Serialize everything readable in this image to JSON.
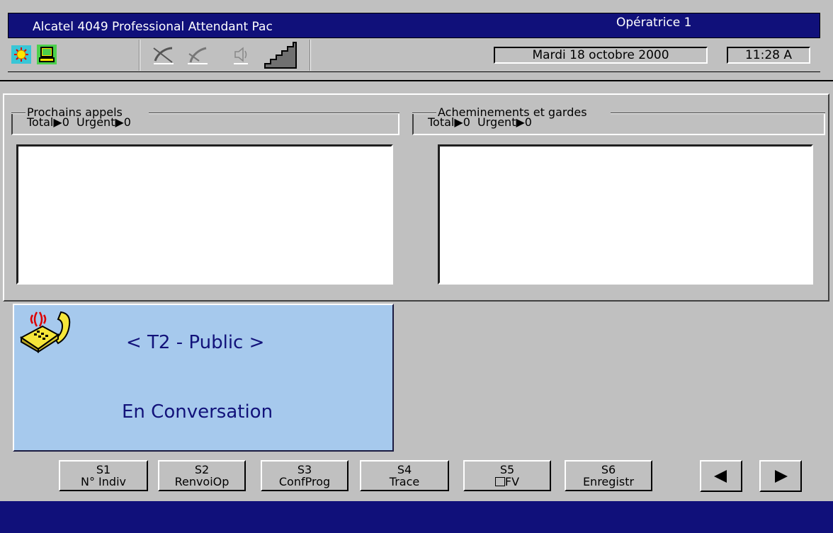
{
  "window": {
    "title": "Alcatel 4049 Professional Attendant Pac",
    "operator": "Opératrice 1"
  },
  "toolbar": {
    "date": "Mardi 18 octobre 2000",
    "time": "11:28 A",
    "icons": [
      "sun-icon",
      "monitor-icon",
      "handset-muted-icon",
      "handset-icon",
      "speaker-icon",
      "stairs-level-icon"
    ]
  },
  "queues": {
    "next_calls": {
      "title": "Prochains appels",
      "total_label": "Total",
      "total": "0",
      "urgent_label": "Urgent",
      "urgent": "0"
    },
    "routing": {
      "title": "Acheminements et gardes",
      "total_label": "Total",
      "total": "0",
      "urgent_label": "Urgent",
      "urgent": "0"
    }
  },
  "call": {
    "line": "< T2 - Public >",
    "status": "En Conversation"
  },
  "function_keys": [
    {
      "key": "S1",
      "label": "N° Indiv"
    },
    {
      "key": "S2",
      "label": "RenvoiOp"
    },
    {
      "key": "S3",
      "label": "ConfProg"
    },
    {
      "key": "S4",
      "label": "Trace"
    },
    {
      "key": "S5",
      "label": "FV"
    },
    {
      "key": "S6",
      "label": "Enregistr"
    }
  ],
  "colors": {
    "title_bar": "#10107a",
    "card": "#a6c9ed",
    "card_text": "#12127a",
    "face": "#c0c0c0"
  }
}
